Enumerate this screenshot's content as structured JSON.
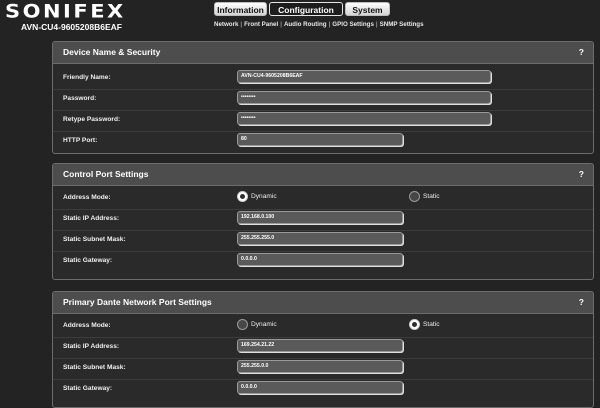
{
  "header": {
    "brand": "SONIFEX",
    "device_name": "AVN-CU4-9605208B6EAF"
  },
  "main_tabs": [
    {
      "label": "Information",
      "active": false
    },
    {
      "label": "Configuration",
      "active": true
    },
    {
      "label": "System",
      "active": false
    }
  ],
  "sub_tabs": [
    "Network",
    "Front Panel",
    "Audio Routing",
    "GPIO Settings",
    "SNMP Settings"
  ],
  "device_security": {
    "title": "Device Name & Security",
    "help": "?",
    "friendly_name": {
      "label": "Friendly Name:",
      "value": "AVN-CU4-9605208B6EAF"
    },
    "password": {
      "label": "Password:",
      "value": "••••••••"
    },
    "retype_password": {
      "label": "Retype Password:",
      "value": "••••••••"
    },
    "http_port": {
      "label": "HTTP Port:",
      "value": "80"
    }
  },
  "control_port": {
    "title": "Control Port Settings",
    "help": "?",
    "address_mode": {
      "label": "Address Mode:",
      "options": [
        "Dynamic",
        "Static"
      ],
      "selected": "Dynamic"
    },
    "ip": {
      "label": "Static IP Address:",
      "value": "192.168.0.100"
    },
    "mask": {
      "label": "Static Subnet Mask:",
      "value": "255.255.255.0"
    },
    "gateway": {
      "label": "Static Gateway:",
      "value": "0.0.0.0"
    }
  },
  "primary_dante": {
    "title": "Primary Dante Network Port Settings",
    "help": "?",
    "address_mode": {
      "label": "Address Mode:",
      "options": [
        "Dynamic",
        "Static"
      ],
      "selected": "Static"
    },
    "ip": {
      "label": "Static IP Address:",
      "value": "169.254.21.22"
    },
    "mask": {
      "label": "Static Subnet Mask:",
      "value": "255.255.0.0"
    },
    "gateway": {
      "label": "Static Gateway:",
      "value": "0.0.0.0"
    }
  }
}
